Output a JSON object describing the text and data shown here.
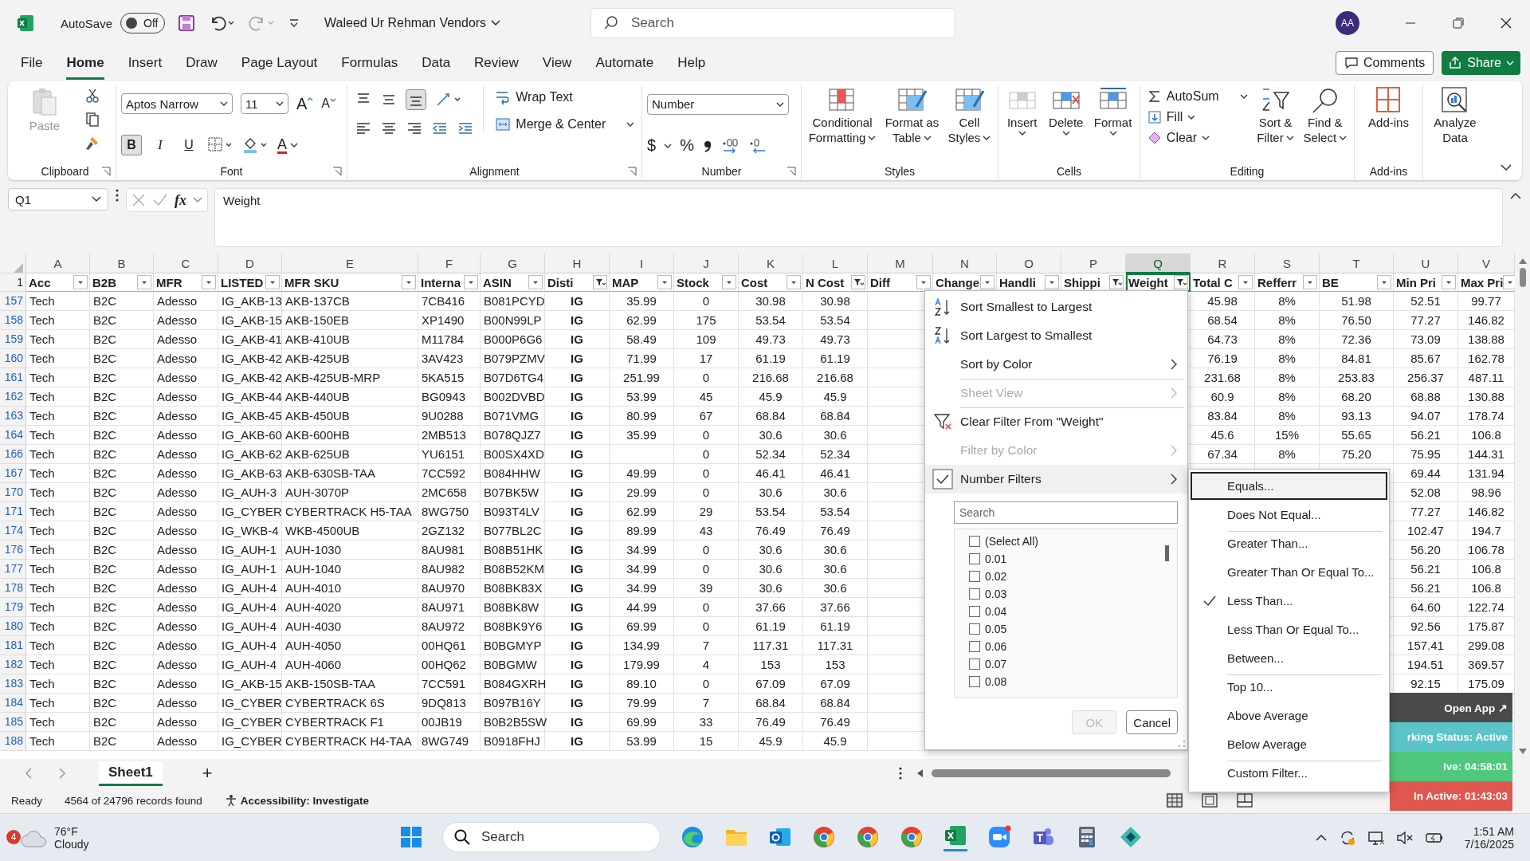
{
  "title_bar": {
    "autosave_label": "AutoSave",
    "autosave_on": false,
    "autosave_state": "Off",
    "document_title": "Waleed Ur Rehman Vendors",
    "search_placeholder": "Search",
    "avatar": "AA"
  },
  "menu_tabs": [
    {
      "label": "File",
      "selected": false
    },
    {
      "label": "Home",
      "selected": true
    },
    {
      "label": "Insert",
      "selected": false
    },
    {
      "label": "Draw",
      "selected": false
    },
    {
      "label": "Page Layout",
      "selected": false
    },
    {
      "label": "Formulas",
      "selected": false
    },
    {
      "label": "Data",
      "selected": false
    },
    {
      "label": "Review",
      "selected": false
    },
    {
      "label": "View",
      "selected": false
    },
    {
      "label": "Automate",
      "selected": false
    },
    {
      "label": "Help",
      "selected": false
    }
  ],
  "header_buttons": {
    "comments": "Comments",
    "share": "Share"
  },
  "ribbon": {
    "clipboard": {
      "title": "Clipboard",
      "paste": "Paste"
    },
    "font": {
      "title": "Font",
      "family": "Aptos Narrow",
      "size": "11",
      "grow": "A",
      "shrink": "A",
      "color_letter": "A",
      "styles": [
        {
          "label": "B",
          "selected": true
        },
        {
          "label": "I",
          "selected": false
        },
        {
          "label": "U",
          "selected": false
        }
      ]
    },
    "alignment": {
      "title": "Alignment",
      "wrap": "Wrap Text",
      "merge": "Merge & Center"
    },
    "number": {
      "title": "Number",
      "format": "Number",
      "currency": "$",
      "percent": "%"
    },
    "styles": {
      "title": "Styles",
      "buttons": [
        [
          "Conditional",
          "Formatting"
        ],
        [
          "Format as",
          "Table"
        ],
        [
          "Cell",
          "Styles"
        ]
      ]
    },
    "cells": {
      "title": "Cells",
      "buttons": [
        "Insert",
        "Delete",
        "Format"
      ]
    },
    "editing": {
      "title": "Editing",
      "autosum": "AutoSum",
      "fill": "Fill",
      "clear": "Clear",
      "buttons": [
        [
          "Sort &",
          "Filter"
        ],
        [
          "Find &",
          "Select"
        ]
      ]
    },
    "addins": {
      "title": "Add-ins",
      "button": "Add-ins"
    },
    "analyze": {
      "button": [
        "Analyze",
        "Data"
      ]
    }
  },
  "formula_bar": {
    "name_box": "Q1",
    "fx": "fx",
    "formula": "Weight"
  },
  "sheet": {
    "header_row": "1",
    "columns": [
      {
        "letter": "A",
        "header": "Acc",
        "filtered": false,
        "selected": false
      },
      {
        "letter": "B",
        "header": "B2B",
        "filtered": false,
        "selected": false
      },
      {
        "letter": "C",
        "header": "MFR",
        "filtered": false,
        "selected": false
      },
      {
        "letter": "D",
        "header": "LISTED",
        "filtered": false,
        "selected": false
      },
      {
        "letter": "E",
        "header": "MFR SKU",
        "filtered": false,
        "selected": false
      },
      {
        "letter": "F",
        "header": "Interna",
        "filtered": false,
        "selected": false
      },
      {
        "letter": "G",
        "header": "ASIN",
        "filtered": false,
        "selected": false
      },
      {
        "letter": "H",
        "header": "Disti",
        "filtered": true,
        "selected": false
      },
      {
        "letter": "I",
        "header": "MAP",
        "filtered": false,
        "selected": false
      },
      {
        "letter": "J",
        "header": "Stock",
        "filtered": false,
        "selected": false
      },
      {
        "letter": "K",
        "header": "Cost",
        "filtered": false,
        "selected": false
      },
      {
        "letter": "L",
        "header": "N Cost",
        "filtered": true,
        "selected": false
      },
      {
        "letter": "M",
        "header": "Diff",
        "filtered": false,
        "selected": false
      },
      {
        "letter": "N",
        "header": "Change",
        "filtered": false,
        "selected": false
      },
      {
        "letter": "O",
        "header": "Handli",
        "filtered": false,
        "selected": false
      },
      {
        "letter": "P",
        "header": "Shippi",
        "filtered": true,
        "selected": false
      },
      {
        "letter": "Q",
        "header": "Weight",
        "filtered": true,
        "selected": true
      },
      {
        "letter": "R",
        "header": "Total C",
        "filtered": false,
        "selected": false
      },
      {
        "letter": "S",
        "header": "Refferr",
        "filtered": false,
        "selected": false
      },
      {
        "letter": "T",
        "header": "BE",
        "filtered": false,
        "selected": false
      },
      {
        "letter": "U",
        "header": "Min Pri",
        "filtered": false,
        "selected": false
      },
      {
        "letter": "V",
        "header": "Max Pri",
        "filtered": false,
        "selected": false
      }
    ],
    "rows": [
      {
        "num": "157",
        "cells": {
          "A": "Tech",
          "B": "B2C",
          "C": "Adesso",
          "D": "IG_AKB-13",
          "E": "AKB-137CB",
          "F": "7CB416",
          "G": "B081PCYD",
          "H": "IG",
          "I": "35.99",
          "J": "0",
          "K": "30.98",
          "L": "30.98",
          "R": "45.98",
          "S": "8%",
          "T": "51.98",
          "U": "52.51",
          "V": "99.77"
        }
      },
      {
        "num": "158",
        "cells": {
          "A": "Tech",
          "B": "B2C",
          "C": "Adesso",
          "D": "IG_AKB-15",
          "E": "AKB-150EB",
          "F": "XP1490",
          "G": "B00N99LP",
          "H": "IG",
          "I": "62.99",
          "J": "175",
          "K": "53.54",
          "L": "53.54",
          "R": "68.54",
          "S": "8%",
          "T": "76.50",
          "U": "77.27",
          "V": "146.82"
        }
      },
      {
        "num": "159",
        "cells": {
          "A": "Tech",
          "B": "B2C",
          "C": "Adesso",
          "D": "IG_AKB-41",
          "E": "AKB-410UB",
          "F": "M11784",
          "G": "B000P6G6",
          "H": "IG",
          "I": "58.49",
          "J": "109",
          "K": "49.73",
          "L": "49.73",
          "R": "64.73",
          "S": "8%",
          "T": "72.36",
          "U": "73.09",
          "V": "138.88"
        }
      },
      {
        "num": "160",
        "cells": {
          "A": "Tech",
          "B": "B2C",
          "C": "Adesso",
          "D": "IG_AKB-42",
          "E": "AKB-425UB",
          "F": "3AV423",
          "G": "B079PZMV",
          "H": "IG",
          "I": "71.99",
          "J": "17",
          "K": "61.19",
          "L": "61.19",
          "R": "76.19",
          "S": "8%",
          "T": "84.81",
          "U": "85.67",
          "V": "162.78"
        }
      },
      {
        "num": "161",
        "cells": {
          "A": "Tech",
          "B": "B2C",
          "C": "Adesso",
          "D": "IG_AKB-42",
          "E": "AKB-425UB-MRP",
          "F": "5KA515",
          "G": "B07D6TG4",
          "H": "IG",
          "I": "251.99",
          "J": "0",
          "K": "216.68",
          "L": "216.68",
          "R": "231.68",
          "S": "8%",
          "T": "253.83",
          "U": "256.37",
          "V": "487.11"
        }
      },
      {
        "num": "162",
        "cells": {
          "A": "Tech",
          "B": "B2C",
          "C": "Adesso",
          "D": "IG_AKB-44",
          "E": "AKB-440UB",
          "F": "BG0943",
          "G": "B002DVBD",
          "H": "IG",
          "I": "53.99",
          "J": "45",
          "K": "45.9",
          "L": "45.9",
          "R": "60.9",
          "S": "8%",
          "T": "68.20",
          "U": "68.88",
          "V": "130.88"
        }
      },
      {
        "num": "163",
        "cells": {
          "A": "Tech",
          "B": "B2C",
          "C": "Adesso",
          "D": "IG_AKB-45",
          "E": "AKB-450UB",
          "F": "9U0288",
          "G": "B071VMG",
          "H": "IG",
          "I": "80.99",
          "J": "67",
          "K": "68.84",
          "L": "68.84",
          "R": "83.84",
          "S": "8%",
          "T": "93.13",
          "U": "94.07",
          "V": "178.74"
        }
      },
      {
        "num": "164",
        "cells": {
          "A": "Tech",
          "B": "B2C",
          "C": "Adesso",
          "D": "IG_AKB-60",
          "E": "AKB-600HB",
          "F": "2MB513",
          "G": "B078QJZ7",
          "H": "IG",
          "I": "35.99",
          "J": "0",
          "K": "30.6",
          "L": "30.6",
          "R": "45.6",
          "S": "15%",
          "T": "55.65",
          "U": "56.21",
          "V": "106.8"
        }
      },
      {
        "num": "166",
        "cells": {
          "A": "Tech",
          "B": "B2C",
          "C": "Adesso",
          "D": "IG_AKB-62",
          "E": "AKB-625UB",
          "F": "YU6151",
          "G": "B00SX4XD",
          "H": "IG",
          "J": "0",
          "K": "52.34",
          "L": "52.34",
          "R": "67.34",
          "S": "8%",
          "T": "75.20",
          "U": "75.95",
          "V": "144.31"
        }
      },
      {
        "num": "167",
        "cells": {
          "A": "Tech",
          "B": "B2C",
          "C": "Adesso",
          "D": "IG_AKB-63",
          "E": "AKB-630SB-TAA",
          "F": "7CC592",
          "G": "B084HHW",
          "H": "IG",
          "I": "49.99",
          "J": "0",
          "K": "46.41",
          "L": "46.41",
          "U": "69.44",
          "V": "131.94"
        }
      },
      {
        "num": "170",
        "cells": {
          "A": "Tech",
          "B": "B2C",
          "C": "Adesso",
          "D": "IG_AUH-3",
          "E": "AUH-3070P",
          "F": "2MC658",
          "G": "B07BK5W",
          "H": "IG",
          "I": "29.99",
          "J": "0",
          "K": "30.6",
          "L": "30.6",
          "U": "52.08",
          "V": "98.96"
        }
      },
      {
        "num": "171",
        "cells": {
          "A": "Tech",
          "B": "B2C",
          "C": "Adesso",
          "D": "IG_CYBER",
          "E": "CYBERTRACK H5-TAA",
          "F": "8WG750",
          "G": "B093T4LV",
          "H": "IG",
          "I": "62.99",
          "J": "29",
          "K": "53.54",
          "L": "53.54",
          "U": "77.27",
          "V": "146.82"
        }
      },
      {
        "num": "174",
        "cells": {
          "A": "Tech",
          "B": "B2C",
          "C": "Adesso",
          "D": "IG_WKB-4",
          "E": "WKB-4500UB",
          "F": "2GZ132",
          "G": "B077BL2C",
          "H": "IG",
          "I": "89.99",
          "J": "43",
          "K": "76.49",
          "L": "76.49",
          "U": "102.47",
          "V": "194.7"
        }
      },
      {
        "num": "176",
        "cells": {
          "A": "Tech",
          "B": "B2C",
          "C": "Adesso",
          "D": "IG_AUH-1",
          "E": "AUH-1030",
          "F": "8AU981",
          "G": "B08B51HK",
          "H": "IG",
          "I": "34.99",
          "J": "0",
          "K": "30.6",
          "L": "30.6",
          "U": "56.20",
          "V": "106.78"
        }
      },
      {
        "num": "177",
        "cells": {
          "A": "Tech",
          "B": "B2C",
          "C": "Adesso",
          "D": "IG_AUH-1",
          "E": "AUH-1040",
          "F": "8AU982",
          "G": "B08B52KM",
          "H": "IG",
          "I": "34.99",
          "J": "0",
          "K": "30.6",
          "L": "30.6",
          "U": "56.21",
          "V": "106.8"
        }
      },
      {
        "num": "178",
        "cells": {
          "A": "Tech",
          "B": "B2C",
          "C": "Adesso",
          "D": "IG_AUH-4",
          "E": "AUH-4010",
          "F": "8AU970",
          "G": "B08BK83X",
          "H": "IG",
          "I": "34.99",
          "J": "39",
          "K": "30.6",
          "L": "30.6",
          "U": "56.21",
          "V": "106.8"
        }
      },
      {
        "num": "179",
        "cells": {
          "A": "Tech",
          "B": "B2C",
          "C": "Adesso",
          "D": "IG_AUH-4",
          "E": "AUH-4020",
          "F": "8AU971",
          "G": "B08BK8W",
          "H": "IG",
          "I": "44.99",
          "J": "0",
          "K": "37.66",
          "L": "37.66",
          "U": "64.60",
          "V": "122.74"
        }
      },
      {
        "num": "180",
        "cells": {
          "A": "Tech",
          "B": "B2C",
          "C": "Adesso",
          "D": "IG_AUH-4",
          "E": "AUH-4030",
          "F": "8AU972",
          "G": "B08BK9Y6",
          "H": "IG",
          "I": "69.99",
          "J": "0",
          "K": "61.19",
          "L": "61.19",
          "U": "92.56",
          "V": "175.87"
        }
      },
      {
        "num": "181",
        "cells": {
          "A": "Tech",
          "B": "B2C",
          "C": "Adesso",
          "D": "IG_AUH-4",
          "E": "AUH-4050",
          "F": "00HQ61",
          "G": "B0BGMYP",
          "H": "IG",
          "I": "134.99",
          "J": "7",
          "K": "117.31",
          "L": "117.31",
          "U": "157.41",
          "V": "299.08"
        }
      },
      {
        "num": "182",
        "cells": {
          "A": "Tech",
          "B": "B2C",
          "C": "Adesso",
          "D": "IG_AUH-4",
          "E": "AUH-4060",
          "F": "00HQ62",
          "G": "B0BGMW",
          "H": "IG",
          "I": "179.99",
          "J": "4",
          "K": "153",
          "L": "153",
          "U": "194.51",
          "V": "369.57"
        }
      },
      {
        "num": "183",
        "cells": {
          "A": "Tech",
          "B": "B2C",
          "C": "Adesso",
          "D": "IG_AKB-15",
          "E": "AKB-150SB-TAA",
          "F": "7CC591",
          "G": "B084GXRH",
          "H": "IG",
          "I": "89.10",
          "J": "0",
          "K": "67.09",
          "L": "67.09",
          "U": "92.15",
          "V": "175.09"
        }
      },
      {
        "num": "184",
        "cells": {
          "A": "Tech",
          "B": "B2C",
          "C": "Adesso",
          "D": "IG_CYBER",
          "E": "CYBERTRACK 6S",
          "F": "9DQ813",
          "G": "B097B16Y",
          "H": "IG",
          "I": "79.99",
          "J": "7",
          "K": "68.84",
          "L": "68.84"
        }
      },
      {
        "num": "185",
        "cells": {
          "A": "Tech",
          "B": "B2C",
          "C": "Adesso",
          "D": "IG_CYBER",
          "E": "CYBERTRACK F1",
          "F": "00JB19",
          "G": "B0B2B5SW",
          "H": "IG",
          "I": "69.99",
          "J": "33",
          "K": "76.49",
          "L": "76.49"
        }
      },
      {
        "num": "188",
        "cells": {
          "A": "Tech",
          "B": "B2C",
          "C": "Adesso",
          "D": "IG_CYBER",
          "E": "CYBERTRACK H4-TAA",
          "F": "8WG749",
          "G": "B0918FHJ",
          "H": "IG",
          "I": "53.99",
          "J": "15",
          "K": "45.9",
          "L": "45.9"
        }
      }
    ]
  },
  "filter_menu": {
    "items": [
      {
        "kind": "sort-asc",
        "label": "Sort Smallest to Largest",
        "disabled": false,
        "checked": false,
        "separator_before": false
      },
      {
        "kind": "sort-desc",
        "label": "Sort Largest to Smallest",
        "disabled": false,
        "checked": false,
        "separator_before": false
      },
      {
        "kind": "submenu",
        "label": "Sort by Color",
        "disabled": false,
        "checked": false,
        "separator_before": false
      },
      {
        "kind": "submenu",
        "label": "Sheet View",
        "disabled": true,
        "checked": false,
        "separator_before": true
      },
      {
        "kind": "clear",
        "label": "Clear Filter From \"Weight\"",
        "disabled": false,
        "checked": false,
        "separator_before": true
      },
      {
        "kind": "submenu",
        "label": "Filter by Color",
        "disabled": true,
        "checked": false,
        "separator_before": false
      },
      {
        "kind": "submenu",
        "label": "Number Filters",
        "disabled": false,
        "checked": true,
        "separator_before": false
      }
    ],
    "search_placeholder": "Search",
    "values": [
      {
        "label": "(Select All)",
        "checked": false
      },
      {
        "label": "0.01",
        "checked": false
      },
      {
        "label": "0.02",
        "checked": false
      },
      {
        "label": "0.03",
        "checked": false
      },
      {
        "label": "0.04",
        "checked": false
      },
      {
        "label": "0.05",
        "checked": false
      },
      {
        "label": "0.06",
        "checked": false
      },
      {
        "label": "0.07",
        "checked": false
      },
      {
        "label": "0.08",
        "checked": false
      }
    ],
    "ok": {
      "label": "OK",
      "disabled": true
    },
    "cancel": "Cancel"
  },
  "number_filters": [
    {
      "label": "Equals...",
      "selected": true,
      "checked": false,
      "separator_before": false
    },
    {
      "label": "Does Not Equal...",
      "selected": false,
      "checked": false,
      "separator_before": false
    },
    {
      "label": "Greater Than...",
      "selected": false,
      "checked": false,
      "separator_before": true
    },
    {
      "label": "Greater Than Or Equal To...",
      "selected": false,
      "checked": false,
      "separator_before": false
    },
    {
      "label": "Less Than...",
      "selected": false,
      "checked": true,
      "separator_before": false
    },
    {
      "label": "Less Than Or Equal To...",
      "selected": false,
      "checked": false,
      "separator_before": false
    },
    {
      "label": "Between...",
      "selected": false,
      "checked": false,
      "separator_before": false
    },
    {
      "label": "Top 10...",
      "selected": false,
      "checked": false,
      "separator_before": true
    },
    {
      "label": "Above Average",
      "selected": false,
      "checked": false,
      "separator_before": false
    },
    {
      "label": "Below Average",
      "selected": false,
      "checked": false,
      "separator_before": false
    },
    {
      "label": "Custom Filter...",
      "selected": false,
      "checked": false,
      "separator_before": true
    }
  ],
  "tracker": [
    {
      "text": "Open App ↗",
      "color": "#4a4a4a"
    },
    {
      "text": "rking Status: Active",
      "color": "#5bc4c8"
    },
    {
      "text": "ive: 04:58:01",
      "color": "#4fc77c"
    },
    {
      "text": "In Active: 01:43:03",
      "color": "#e0574f"
    }
  ],
  "sheet_tabs": [
    {
      "label": "Sheet1",
      "selected": true
    }
  ],
  "add_sheet": "+",
  "status_bar": {
    "mode": "Ready",
    "records": "4564 of 24796 records found",
    "accessibility": "Accessibility: Investigate"
  },
  "taskbar": {
    "weather_badge": "4",
    "temperature": "76°F",
    "condition": "Cloudy",
    "search_placeholder": "Search",
    "time": "1:51 AM",
    "date": "7/16/2025"
  }
}
